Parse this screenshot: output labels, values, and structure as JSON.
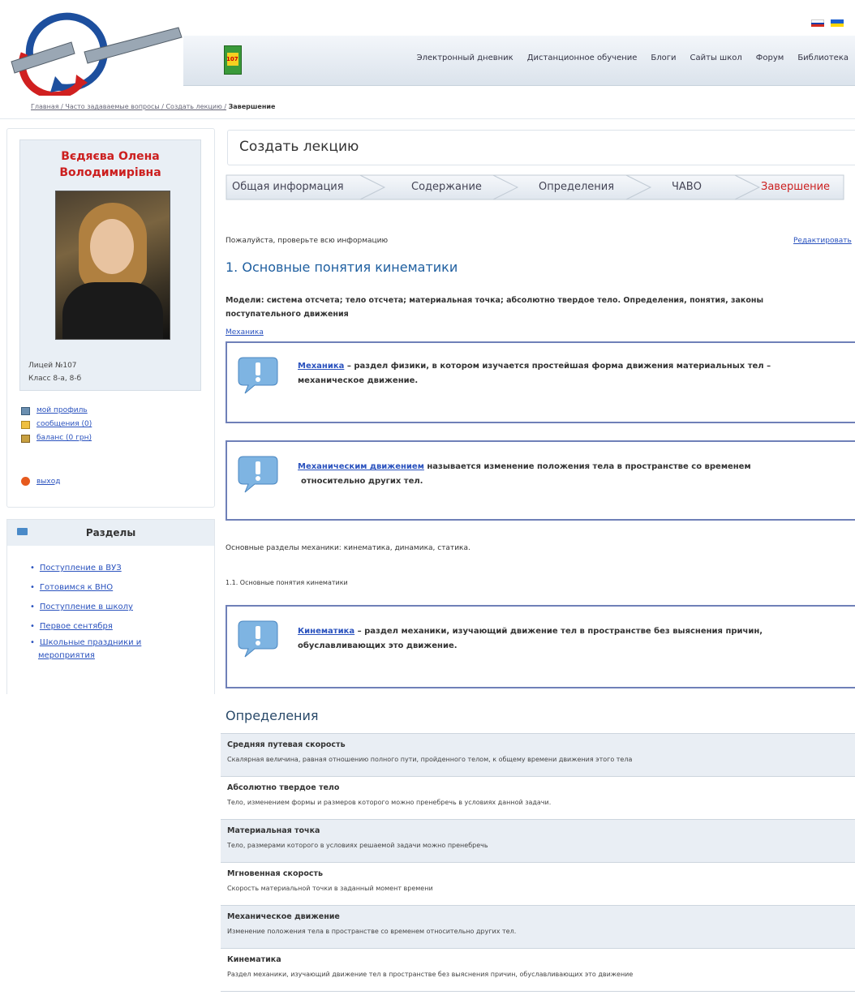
{
  "header": {
    "book_number": "107",
    "nav": [
      "Электронный дневник",
      "Дистанционное обучение",
      "Блоги",
      "Сайты школ",
      "Форум",
      "Библиотека"
    ],
    "flags": [
      {
        "name": "ru-flag",
        "colors": [
          "#ffffff",
          "#1c3fa8",
          "#d52b1e"
        ]
      },
      {
        "name": "ua-flag",
        "colors": [
          "#1a5fd0",
          "#ffd700"
        ]
      }
    ]
  },
  "breadcrumb": {
    "path": "Главная / Часто задаваемые вопросы / Создать лекцию /",
    "current": "Завершение"
  },
  "profile": {
    "name_line1": "Вєдяєва Олена",
    "name_line2": "Володимирівна",
    "school": "Лицей №107",
    "classes": "Класс 8-а, 8-б"
  },
  "user_links": [
    "мой профиль",
    "сообщения (0)",
    "баланс (0 грн)"
  ],
  "logout": "выход",
  "sections": {
    "title": "Разделы",
    "items": [
      "Поступление в ВУЗ",
      "Готовимся к ВНО",
      "Поступление в школу",
      "Первое сентября",
      "Школьные праздники и",
      "мероприятия"
    ]
  },
  "page": {
    "title": "Создать лекцию",
    "steps": [
      "Общая информация",
      "Содержание",
      "Определения",
      "ЧАВО",
      "Завершение"
    ],
    "note": "Пожалуйста, проверьте всю информацию",
    "edit": "Редактировать"
  },
  "lecture": {
    "title": "1. Основные понятия кинематики",
    "subtitle_line1": "Модели: система отсчета; тело отсчета; материальная точка; абсолютно твердое тело. Определения, понятия, законы",
    "subtitle_line2": "поступательного движения",
    "link": "Механика",
    "def1": {
      "term": "Механика",
      "text_line1": " – раздел физики, в котором изучается простейшая форма движения материальных тел –",
      "text_line2": "механическое движение."
    },
    "def2": {
      "term": "Механическим движением",
      "text_line1": " называется изменение положения тела в пространстве со временем",
      "text_line2": "относительно других тел."
    },
    "para1": "Основные разделы механики: кинематика, динамика, статика.",
    "para2": "1.1.   Основные понятия кинематики",
    "def3": {
      "term": "Кинематика",
      "text_line1": " – раздел механики, изучающий движение тел в пространстве без выяснения причин,",
      "text_line2": "обуславливающих это движение."
    }
  },
  "definitions": {
    "title": "Определения",
    "rows": [
      {
        "term": "Средняя путевая скорость",
        "desc": "Скалярная величина, равная отношению полного пути, пройденного телом, к общему времени движения этого тела"
      },
      {
        "term": "Абсолютно твердое тело",
        "desc": "Тело, изменением формы и размеров которого можно пренебречь в условиях данной задачи."
      },
      {
        "term": "Материальная точка",
        "desc": "Тело, размерами которого в условиях решаемой задачи можно пренебречь"
      },
      {
        "term": "Мгновенная скорость",
        "desc": "Скорость материальной точки в заданный момент времени"
      },
      {
        "term": "Механическое движение",
        "desc": "Изменение положения тела в пространстве со временем относительно других тел."
      },
      {
        "term": "Кинематика",
        "desc": "Раздел механики, изучающий движение тел в пространстве без выяснения причин, обуславливающих это движение"
      }
    ]
  }
}
